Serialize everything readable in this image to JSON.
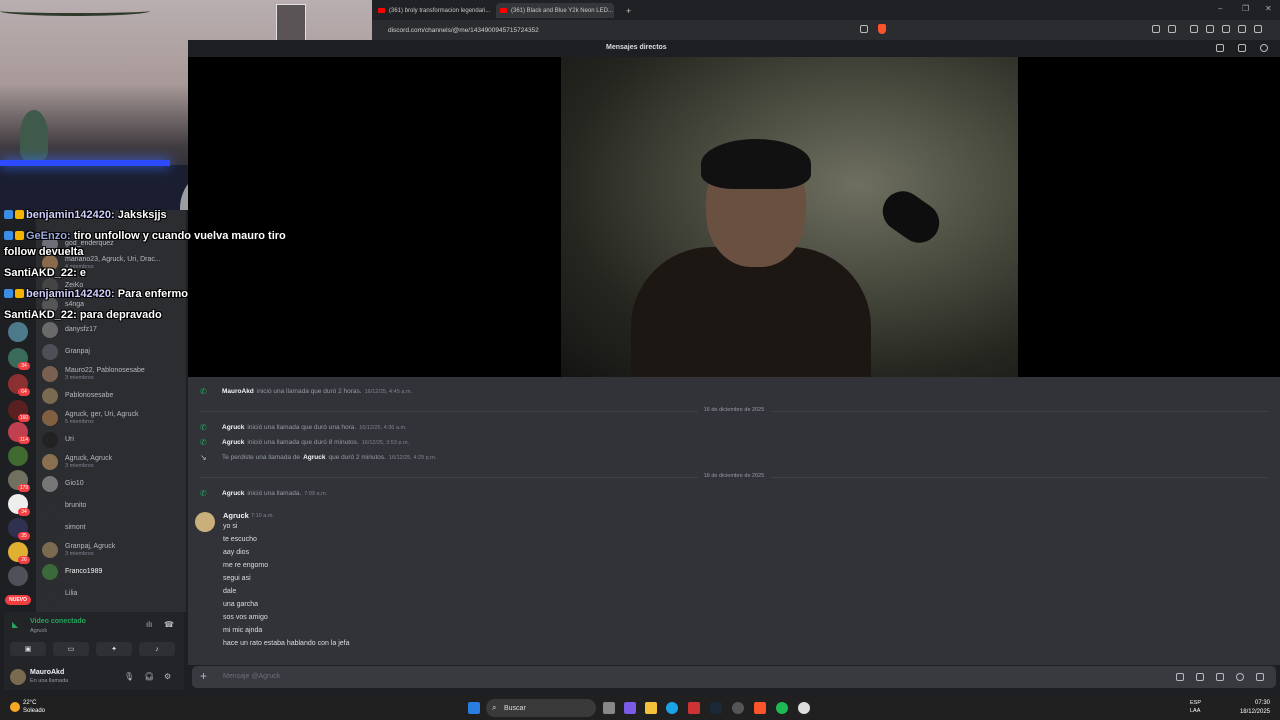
{
  "browser": {
    "tabs": [
      {
        "label": "(361) broly transformacion legendari..."
      },
      {
        "label": "(361) Black and Blue Y2k Neon LED..."
      }
    ],
    "new_tab": "+",
    "url": "discord.com/channels/@me/1434900945715724352",
    "window_controls": [
      "–",
      "❐",
      "✕"
    ]
  },
  "discord": {
    "header_title": "Mensajes directos",
    "dm_list": [
      {
        "name": "god_enderquez",
        "sub": ""
      },
      {
        "name": "mariano23, Agruck, Uri, Drac...",
        "sub": "4 miembros"
      },
      {
        "name": "ZeiKo",
        "sub": ""
      },
      {
        "name": "s4nga",
        "sub": ""
      },
      {
        "name": "danysfz17",
        "sub": ""
      },
      {
        "name": "Granpaj",
        "sub": ""
      },
      {
        "name": "Mauro22, Pablonosesabe",
        "sub": "3 miembros"
      },
      {
        "name": "Pablonosesabe",
        "sub": ""
      },
      {
        "name": "Agruck, ger, Uri, Agruck",
        "sub": "5 miembros"
      },
      {
        "name": "Uri",
        "sub": ""
      },
      {
        "name": "Agruck, Agruck",
        "sub": "3 miembros"
      },
      {
        "name": "Gio10",
        "sub": ""
      },
      {
        "name": "brunito",
        "sub": ""
      },
      {
        "name": "simont",
        "sub": ""
      },
      {
        "name": "Granpaj, Agruck",
        "sub": "3 miembros"
      },
      {
        "name": "Franco1989",
        "sub": ""
      },
      {
        "name": "Lilia",
        "sub": ""
      }
    ],
    "server_badges": [
      "34",
      "64",
      "160",
      "114",
      "179",
      "34",
      "35",
      "26"
    ],
    "nuevo_label": "NUEVO",
    "voice": {
      "title": "Video conectado",
      "subtitle": "Agruck"
    },
    "user": {
      "name": "MauroAkd",
      "status": "En una llamada"
    },
    "chat": {
      "calls": [
        {
          "user": "MauroAkd",
          "text": "inició una llamada que duró 2 horas.",
          "time": "16/12/25, 4:45 a.m."
        },
        {
          "user": "Agruck",
          "text": "inició una llamada que duró una hora.",
          "time": "16/12/25, 4:36 a.m."
        },
        {
          "user": "Agruck",
          "text": "inició una llamada que duró 8 minutos.",
          "time": "16/12/25, 3:53 p.m."
        },
        {
          "prefix": "Te perdiste una llamada de",
          "user": "Agruck",
          "text": "que duró 2 minutos.",
          "time": "16/12/25, 4:29 p.m."
        },
        {
          "user": "Agruck",
          "text": "inició una llamada.",
          "time": "7:09 a.m."
        }
      ],
      "date_dividers": [
        "16 de diciembre de 2025",
        "18 de diciembre de 2025"
      ],
      "message": {
        "author": "Agruck",
        "time": "7:10 a.m.",
        "lines": [
          "yo si",
          "te escucho",
          "aay dios",
          "me re engomo",
          "segui asi",
          "dale",
          "una garcha",
          "sos vos amigo",
          "mi mic ajnda",
          "hace un rato estaba hablando con la jefa"
        ]
      },
      "composer_placeholder": "Mensaje @Agruck"
    }
  },
  "overlay_chat": [
    {
      "user": "benjamin142420:",
      "text": "Jaksksjjs"
    },
    {
      "user": "GeEnzo:",
      "text": "tiro unfollow y cuando vuelva mauro tiro"
    },
    {
      "user": "",
      "text": "follow devuelta"
    },
    {
      "user": "SantiAKD_22:",
      "text": "e"
    },
    {
      "user": "benjamin142420:",
      "text": "Para enfermo"
    },
    {
      "user": "SantiAKD_22:",
      "text": "para depravado"
    }
  ],
  "taskbar": {
    "weather_temp": "22°C",
    "weather_desc": "Soleado",
    "search_label": "Buscar",
    "lang_top": "ESP",
    "lang_bottom": "LAA",
    "time": "07:30",
    "date": "18/12/2025"
  },
  "colors": {
    "discord_bg": "#313338",
    "sidebar_bg": "#2b2d31",
    "call_green": "#23a55a",
    "badge_red": "#f23f42"
  }
}
